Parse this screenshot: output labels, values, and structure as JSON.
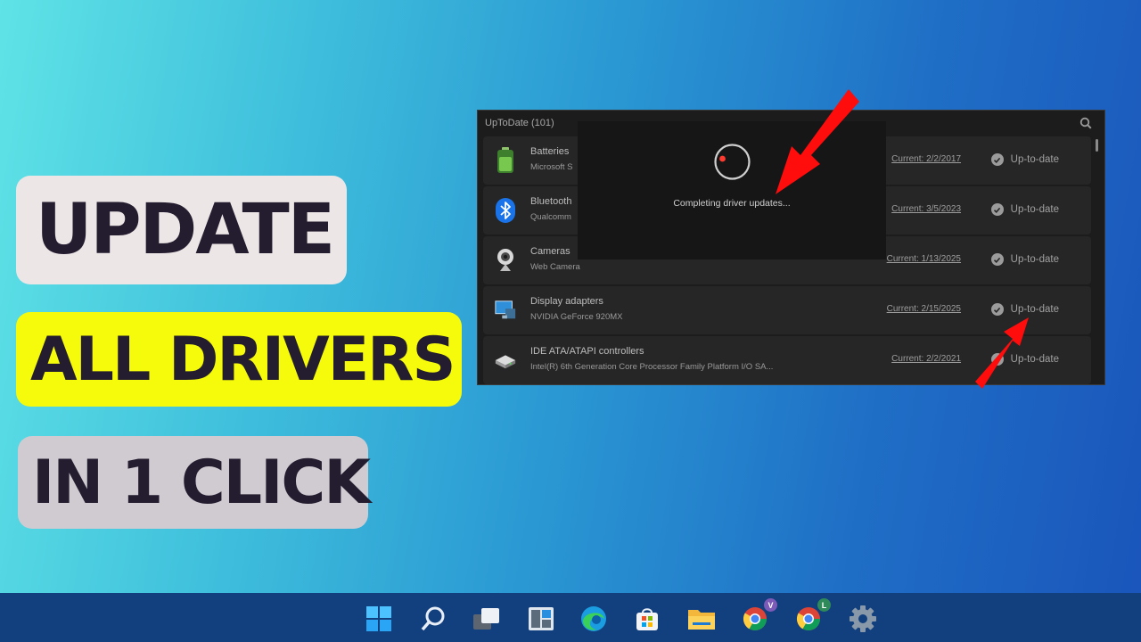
{
  "headline": {
    "line1": "UPDATE",
    "line2": "ALL DRIVERS",
    "line3": "IN 1 CLICK"
  },
  "app": {
    "title": "UpToDate (101)",
    "icons": {
      "search": "search-icon"
    },
    "devices": [
      {
        "name": "Batteries",
        "sub": "Microsoft S",
        "current": "Current: 2/2/2017",
        "status": "Up-to-date",
        "icon": "battery-icon"
      },
      {
        "name": "Bluetooth",
        "sub": "Qualcomm",
        "current": "Current: 3/5/2023",
        "status": "Up-to-date",
        "icon": "bluetooth-icon"
      },
      {
        "name": "Cameras",
        "sub": "Web Camera",
        "current": "Current: 1/13/2025",
        "status": "Up-to-date",
        "icon": "webcam-icon"
      },
      {
        "name": "Display adapters",
        "sub": "NVIDIA GeForce 920MX",
        "current": "Current: 2/15/2025",
        "status": "Up-to-date",
        "icon": "monitor-icon"
      },
      {
        "name": "IDE ATA/ATAPI controllers",
        "sub": "Intel(R) 6th Generation Core Processor Family Platform I/O SA...",
        "current": "Current: 2/2/2021",
        "status": "Up-to-date",
        "icon": "disk-drive-icon"
      }
    ]
  },
  "dialog": {
    "message": "Completing driver updates..."
  },
  "taskbar": {
    "items": [
      "windows-start-icon",
      "search-icon",
      "task-view-icon",
      "widgets-icon",
      "edge-browser-icon",
      "store-icon",
      "file-explorer-icon",
      "chrome-profile-v-icon",
      "chrome-profile-l-icon",
      "settings-icon"
    ],
    "badges": {
      "chrome_v": "V",
      "chrome_l": "L"
    }
  },
  "colors": {
    "accent_red": "#ff0c0c",
    "pill_yellow": "#f5fb0b",
    "text_dark": "#241c2f"
  }
}
